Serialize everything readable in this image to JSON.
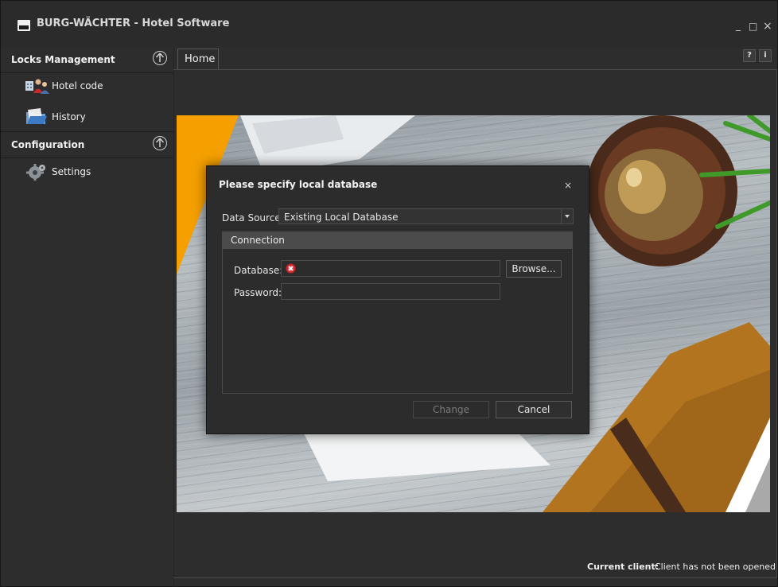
{
  "window": {
    "title": "BURG-WÄCHTER - Hotel Software",
    "minimize": "_",
    "maximize": "□",
    "close": "×"
  },
  "sidebar": {
    "groups": [
      {
        "label": "Locks Management",
        "items": [
          {
            "label": "Hotel code",
            "icon": "hotel-code-icon"
          },
          {
            "label": "History",
            "icon": "history-icon"
          }
        ]
      },
      {
        "label": "Configuration",
        "items": [
          {
            "label": "Settings",
            "icon": "settings-gear-icon"
          }
        ]
      }
    ]
  },
  "tabs": [
    {
      "label": "Home"
    }
  ],
  "top_buttons": {
    "help": "?",
    "info": "i"
  },
  "dialog": {
    "title": "Please specify local database",
    "close": "×",
    "data_source_label": "Data Source:",
    "data_source_value": "Existing Local Database",
    "group_title": "Connection",
    "database_label": "Database:",
    "database_value": "",
    "password_label": "Password:",
    "password_value": "",
    "browse_label": "Browse...",
    "change_label": "Change",
    "cancel_label": "Cancel"
  },
  "status": {
    "current_client_label": "Current client:",
    "current_client_value": "Client has not been opened"
  },
  "colors": {
    "accent_orange": "#f5a000",
    "error_red": "#d0252b",
    "background": "#2b2b2b"
  }
}
